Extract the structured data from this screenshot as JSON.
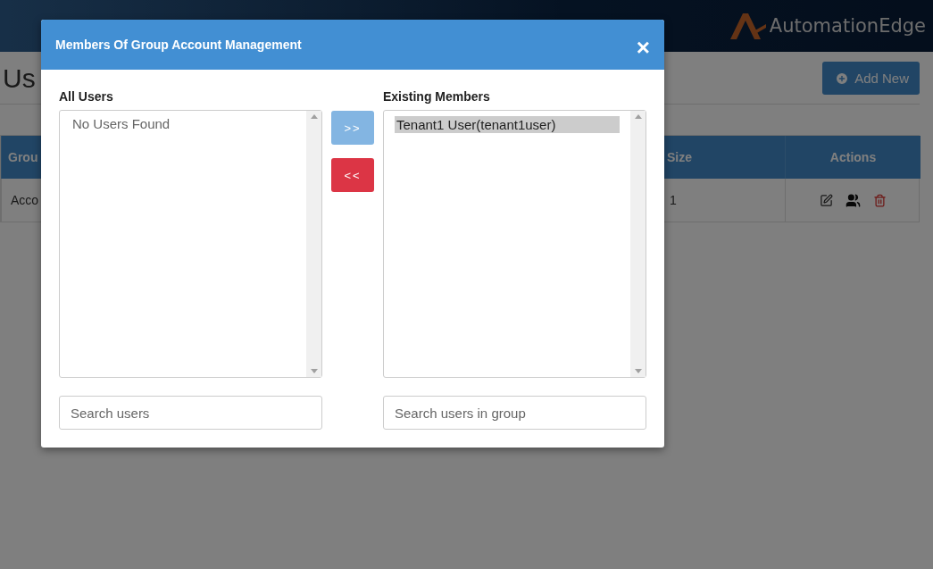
{
  "header": {
    "logo_text": "AutomationEdge"
  },
  "page": {
    "title": "Us",
    "add_button": "Add New"
  },
  "table": {
    "columns": [
      "Grou",
      "Size",
      "Actions"
    ],
    "rows": [
      {
        "cells": [
          "Acco",
          "1"
        ]
      }
    ]
  },
  "modal": {
    "title": "Members Of Group Account Management",
    "close": "×",
    "left": {
      "label": "All Users",
      "empty": "No Users Found",
      "search": {
        "placeholder": "Search users"
      }
    },
    "right": {
      "label": "Existing Members",
      "items": [
        {
          "text": "Tenant1 User(tenant1user)",
          "selected": true
        }
      ],
      "search": {
        "placeholder": "Search users in group"
      }
    },
    "buttons": [
      {
        "label": ">>",
        "kind": "add",
        "disabled": true
      },
      {
        "label": "<<",
        "kind": "remove",
        "disabled": false
      }
    ]
  }
}
